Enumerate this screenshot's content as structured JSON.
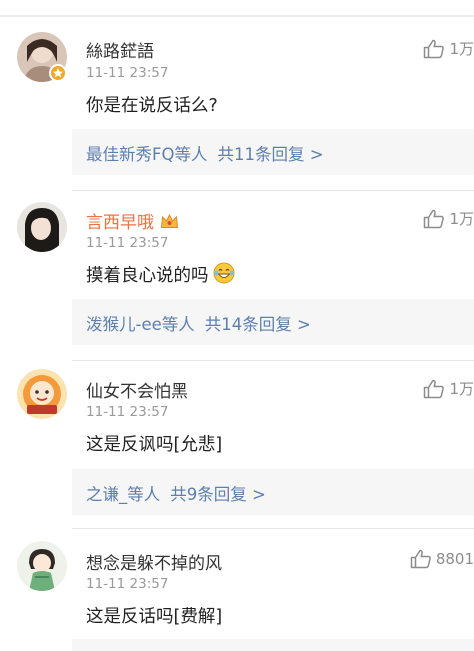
{
  "colors": {
    "username": "#333333",
    "vip_username": "#eb7340",
    "time": "#9a9a9a",
    "reply_link": "#5d7faf",
    "reply_bg": "#f6f6f6",
    "like": "#8c8c8c"
  },
  "comments": [
    {
      "username": "絲路鋩語",
      "time": "11-11 23:57",
      "text": "你是在说反话么?",
      "likes": "1万",
      "reply_users": "最佳新秀FQ等人",
      "reply_count": "共11条回复 >",
      "avatar": "avatar-photo"
    },
    {
      "username": "言西早哦",
      "time": "11-11 23:57",
      "text": "摸着良心说的吗",
      "likes": "1万",
      "reply_users": "泼猴儿-ee等人",
      "reply_count": "共14条回复 >",
      "avatar": "avatar-photo"
    },
    {
      "username": "仙女不会怕黑",
      "time": "11-11 23:57",
      "text": "这是反讽吗[允悲]",
      "likes": "1万",
      "reply_users": "之谦_等人",
      "reply_count": "共9条回复 >",
      "avatar": "avatar-cartoon"
    },
    {
      "username": "想念是躲不掉的风",
      "time": "11-11 23:57",
      "text": "这是反话吗[费解]",
      "likes": "8801",
      "avatar": "avatar-cartoon"
    }
  ]
}
